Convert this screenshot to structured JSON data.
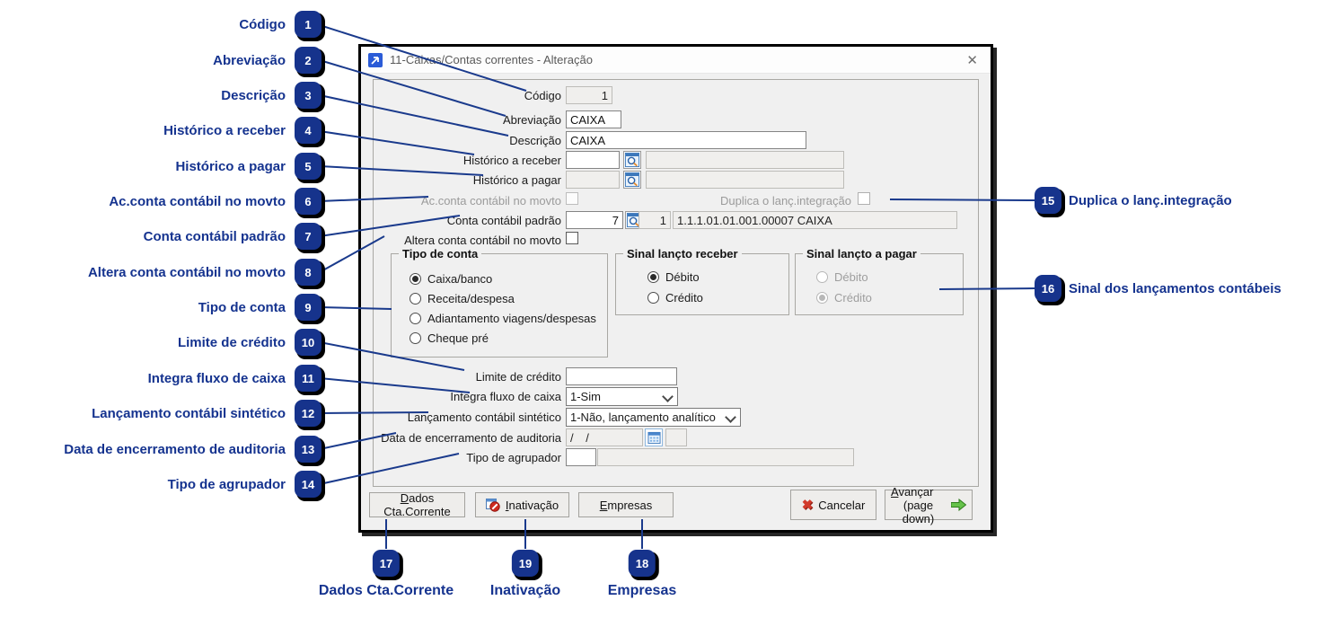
{
  "window": {
    "title": "11-Caixas/Contas correntes - Alteração",
    "close_glyph": "✕"
  },
  "colors": {
    "accent_navy": "#15338f",
    "badge_blue": "#16338c",
    "line_blue": "#1a3a8c",
    "disabled_text": "#9b9b9b",
    "cancel_red": "#d23b2c",
    "advance_green": "#66c24a"
  },
  "fields": {
    "codigo": {
      "label": "Código",
      "value": "1"
    },
    "abreviacao": {
      "label": "Abreviação",
      "value": "CAIXA"
    },
    "descricao": {
      "label": "Descrição",
      "value": "CAIXA"
    },
    "historico_receber": {
      "label": "Histórico a receber",
      "code": "",
      "description": ""
    },
    "historico_pagar": {
      "label": "Histórico a pagar",
      "code": "",
      "description": ""
    },
    "ac_conta": {
      "label": "Ac.conta contábil no movto",
      "checked": false
    },
    "duplica": {
      "label": "Duplica o lanç.integração",
      "checked": false
    },
    "conta_padrao": {
      "label": "Conta contábil padrão",
      "code": "7",
      "empresa": "1",
      "conta": "1.1.1.01.01.001.00007 CAIXA"
    },
    "altera_conta": {
      "label": "Altera conta contábil no movto",
      "checked": false
    },
    "limite": {
      "label": "Limite de crédito",
      "value": ""
    },
    "integra_fluxo": {
      "label": "Integra fluxo de caixa",
      "value": "1-Sim"
    },
    "lanc_sintetico": {
      "label": "Lançamento contábil sintético",
      "value": "1-Não, lançamento analítico"
    },
    "data_auditoria": {
      "label": "Data de encerramento de auditoria",
      "value": "/ /"
    },
    "tipo_agrupador": {
      "label": "Tipo de agrupador",
      "code": "",
      "description": ""
    }
  },
  "groups": {
    "tipo_conta": {
      "caption": "Tipo de conta",
      "options": [
        {
          "label": "Caixa/banco",
          "selected": true
        },
        {
          "label": "Receita/despesa",
          "selected": false
        },
        {
          "label": "Adiantamento viagens/despesas",
          "selected": false
        },
        {
          "label": "Cheque pré",
          "selected": false
        }
      ]
    },
    "sinal_receber": {
      "caption": "Sinal lançto receber",
      "options": [
        {
          "label": "Débito",
          "selected": true
        },
        {
          "label": "Crédito",
          "selected": false
        }
      ]
    },
    "sinal_pagar": {
      "caption": "Sinal lançto a pagar",
      "disabled": true,
      "options": [
        {
          "label": "Débito",
          "selected": false
        },
        {
          "label": "Crédito",
          "selected": true
        }
      ]
    }
  },
  "buttons": {
    "dados": {
      "key": "D",
      "rest": "ados Cta.Corrente"
    },
    "inativacao": {
      "key": "I",
      "rest": "nativação"
    },
    "empresas": {
      "key": "E",
      "rest": "mpresas"
    },
    "cancelar": {
      "label": "Cancelar",
      "icon": "✖"
    },
    "avancar": {
      "key": "A",
      "rest": "vançar",
      "line2": "(page down)"
    }
  },
  "callouts": {
    "left": [
      {
        "num": "1",
        "label": "Código"
      },
      {
        "num": "2",
        "label": "Abreviação"
      },
      {
        "num": "3",
        "label": "Descrição"
      },
      {
        "num": "4",
        "label": "Histórico a receber"
      },
      {
        "num": "5",
        "label": "Histórico a pagar"
      },
      {
        "num": "6",
        "label": "Ac.conta contábil no movto"
      },
      {
        "num": "7",
        "label": "Conta contábil padrão"
      },
      {
        "num": "8",
        "label": "Altera conta contábil no movto"
      },
      {
        "num": "9",
        "label": "Tipo de conta"
      },
      {
        "num": "10",
        "label": "Limite de crédito"
      },
      {
        "num": "11",
        "label": "Integra fluxo de caixa"
      },
      {
        "num": "12",
        "label": "Lançamento contábil sintético"
      },
      {
        "num": "13",
        "label": "Data de encerramento de auditoria"
      },
      {
        "num": "14",
        "label": "Tipo de agrupador"
      }
    ],
    "right": [
      {
        "num": "15",
        "label": "Duplica o lanç.integração"
      },
      {
        "num": "16",
        "label": "Sinal dos lançamentos contábeis"
      }
    ],
    "bottom": [
      {
        "num": "17",
        "label": "Dados Cta.Corrente"
      },
      {
        "num": "19",
        "label": "Inativação"
      },
      {
        "num": "18",
        "label": "Empresas"
      }
    ]
  }
}
